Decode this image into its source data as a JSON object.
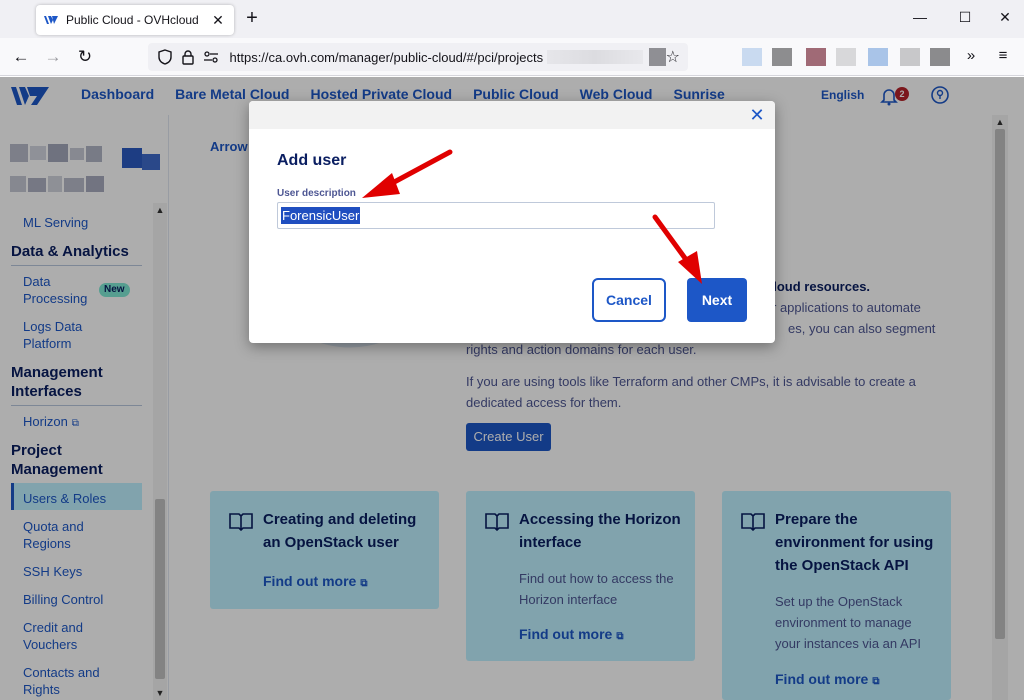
{
  "browser": {
    "tab_title": "Public Cloud - OVHcloud",
    "tab_close": "✕",
    "new_tab": "+",
    "minimize": "—",
    "maximize": "☐",
    "close": "✕",
    "url": "https://ca.ovh.com/manager/public-cloud/#/pci/projects",
    "back": "←",
    "forward": "→",
    "reload": "↻",
    "star": "☆",
    "overflow": "»",
    "menu": "≡"
  },
  "header": {
    "nav": [
      "Dashboard",
      "Bare Metal Cloud",
      "Hosted Private Cloud",
      "Public Cloud",
      "Web Cloud",
      "Sunrise"
    ],
    "language": "English",
    "notification_count": "2"
  },
  "sidebar": {
    "items": [
      {
        "text": "ML Serving"
      },
      {
        "heading": "Data & Analytics"
      },
      {
        "text": "Data Processing",
        "badge": "New"
      },
      {
        "text": "Logs Data Platform"
      },
      {
        "heading": "Management Interfaces"
      },
      {
        "text": "Horizon"
      },
      {
        "heading": "Project Management"
      },
      {
        "text": "Users & Roles"
      },
      {
        "text": "Quota and Regions"
      },
      {
        "text": "SSH Keys"
      },
      {
        "text": "Billing Control"
      },
      {
        "text": "Credit and Vouchers"
      },
      {
        "text": "Contacts and Rights"
      }
    ],
    "labels": {
      "ml_serving": "ML Serving",
      "data_analytics": "Data & Analytics",
      "data_processing_1": "Data",
      "data_processing_2": "Processing",
      "new_badge": "New",
      "logs_1": "Logs Data",
      "logs_2": "Platform",
      "mgmt_1": "Management",
      "mgmt_2": "Interfaces",
      "horizon": "Horizon",
      "proj_1": "Project",
      "proj_2": "Management",
      "users_roles": "Users & Roles",
      "quota_1": "Quota and",
      "quota_2": "Regions",
      "ssh_keys": "SSH Keys",
      "billing": "Billing Control",
      "credit_1": "Credit and",
      "credit_2": "Vouchers",
      "contacts_1": "Contacts and",
      "contacts_2": "Rights"
    }
  },
  "main": {
    "breadcrumb": "Arrow",
    "intro_lines": [
      "cloud resources.",
      "r applications to automate",
      "es, you can also segment",
      "rights and action domains for each user."
    ],
    "intro_para2_1": "If you are using tools like Terraform and other CMPs, it is advisable to create a",
    "intro_para2_2": "dedicated access for them.",
    "create_user": "Create User",
    "cards": [
      {
        "title_1": "Creating and deleting",
        "title_2": "an OpenStack user",
        "link": "Find out more"
      },
      {
        "title_1": "Accessing the Horizon",
        "title_2": "interface",
        "desc_1": "Find out how to access the",
        "desc_2": "Horizon interface",
        "link": "Find out more"
      },
      {
        "title_1": "Prepare the",
        "title_2": "environment for using",
        "title_3": "the OpenStack API",
        "desc_1": "Set up the OpenStack",
        "desc_2": "environment to manage",
        "desc_3": "your instances via an API",
        "link": "Find out more"
      }
    ]
  },
  "modal": {
    "close": "✕",
    "title": "Add user",
    "field_label": "User description",
    "field_value": "ForensicUser",
    "cancel": "Cancel",
    "next": "Next"
  },
  "colors": {
    "brand": "#1d57c7",
    "navy": "#0a1e61",
    "card_bg": "#bef1ff",
    "annotation_arrow": "#e00000"
  }
}
